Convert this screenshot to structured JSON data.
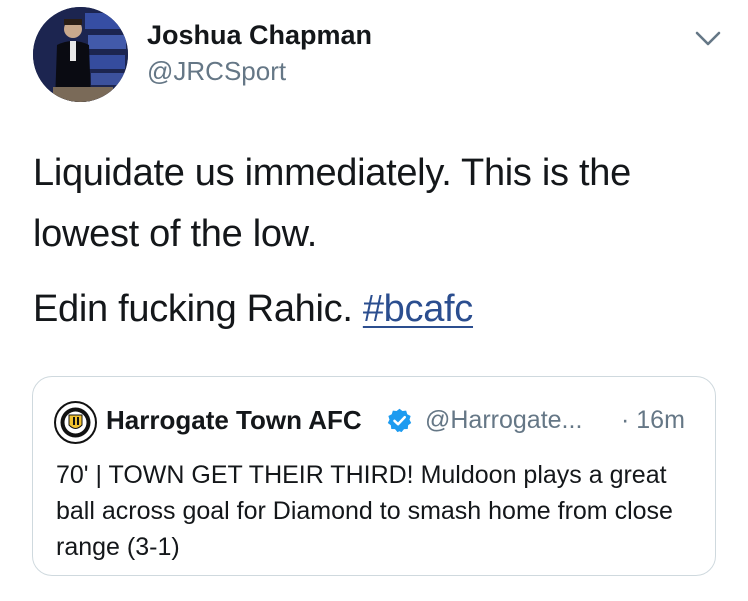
{
  "author": {
    "display_name": "Joshua Chapman",
    "handle": "@JRCSport",
    "avatar_icon": "profile-photo"
  },
  "more_icon": "chevron-down-icon",
  "tweet": {
    "line1": "Liquidate us immediately. This is the lowest of the low.",
    "line2_prefix": "Edin fucking Rahic. ",
    "hashtag": "#bcafc"
  },
  "quoted_tweet": {
    "display_name": "Harrogate Town AFC",
    "verified": true,
    "handle": "@Harrogate...",
    "time": "· 16m",
    "text": "70' | TOWN GET THEIR THIRD! Muldoon plays a great ball across goal for Diamond to smash home from close range (3-1)",
    "avatar_icon": "club-crest-icon",
    "crest_text": "HARROGATE TOWN AFC"
  },
  "colors": {
    "link": "#2b4e8f",
    "muted": "#657786",
    "verified": "#1d9bf0",
    "card_border": "#cfd9de"
  }
}
